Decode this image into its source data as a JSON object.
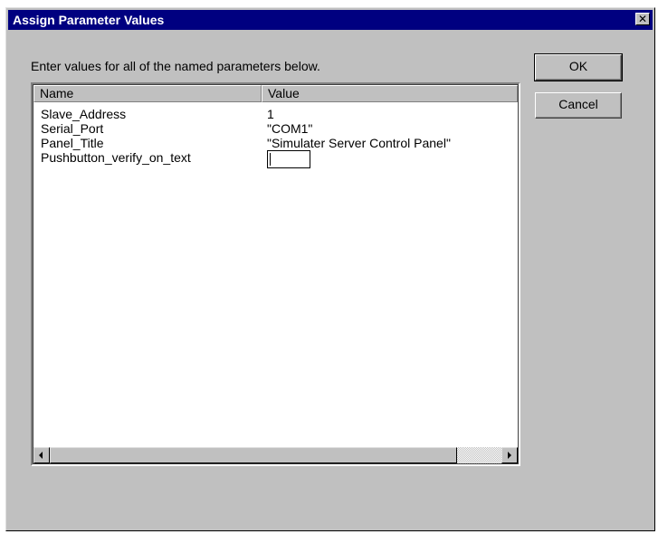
{
  "dialog": {
    "title": "Assign Parameter Values",
    "instructions": "Enter values for all of the named parameters below.",
    "close_icon": "close-icon",
    "ok_label": "OK",
    "cancel_label": "Cancel"
  },
  "table": {
    "columns": [
      "Name",
      "Value"
    ],
    "rows": [
      {
        "name": "Slave_Address",
        "value": "1"
      },
      {
        "name": "Serial_Port",
        "value": "\"COM1\""
      },
      {
        "name": "Panel_Title",
        "value": "\"Simulater Server Control Panel\""
      },
      {
        "name": "Pushbutton_verify_on_text",
        "value": ""
      }
    ],
    "editing_row": 3
  },
  "scrollbar": {
    "left_icon": "arrow-left-icon",
    "right_icon": "arrow-right-icon"
  },
  "colors": {
    "title_bar": "#000080",
    "face": "#c0c0c0"
  }
}
